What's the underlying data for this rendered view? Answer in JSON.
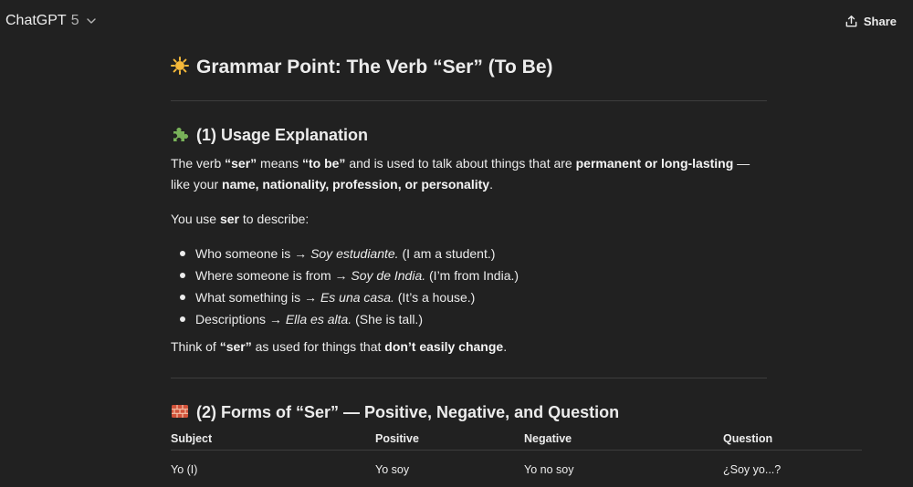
{
  "topbar": {
    "model_name": "ChatGPT",
    "model_version": "5",
    "share_label": "Share"
  },
  "content": {
    "title": "Grammar Point: The Verb “Ser” (To Be)",
    "section1": {
      "heading": "(1) Usage Explanation",
      "para1": {
        "t1": "The verb ",
        "b1": "“ser”",
        "t2": " means ",
        "b2": "“to be”",
        "t3": " and is used to talk about things that are ",
        "b3": "permanent or long-lasting",
        "t4": " — like your ",
        "b4": "name, nationality, profession, or personality",
        "t5": "."
      },
      "para2": {
        "t1": "You use ",
        "b1": "ser",
        "t2": " to describe:"
      },
      "bullets": [
        {
          "lead": "Who someone is → ",
          "example": "Soy estudiante.",
          "gloss": " (I am a student.)"
        },
        {
          "lead": "Where someone is from → ",
          "example": "Soy de India.",
          "gloss": " (I’m from India.)"
        },
        {
          "lead": "What something is → ",
          "example": "Es una casa.",
          "gloss": " (It’s a house.)"
        },
        {
          "lead": "Descriptions → ",
          "example": "Ella es alta.",
          "gloss": " (She is tall.)"
        }
      ],
      "para3": {
        "t1": "Think of ",
        "b1": "“ser”",
        "t2": " as used for things that ",
        "b2": "don’t easily change",
        "t3": "."
      }
    },
    "section2": {
      "heading": "(2) Forms of “Ser” — Positive, Negative, and Question",
      "table": {
        "headers": [
          "Subject",
          "Positive",
          "Negative",
          "Question"
        ],
        "rows": [
          [
            "Yo (I)",
            "Yo soy",
            "Yo no soy",
            "¿Soy yo...?"
          ]
        ]
      }
    }
  },
  "icons": {
    "model_dropdown": "chevron-down-icon",
    "share": "share-icon",
    "title_emoji": "sun-icon",
    "section1_emoji": "puzzle-piece-icon",
    "section2_emoji": "brick-icon"
  },
  "colors": {
    "background": "#212121",
    "text": "#ececec",
    "divider": "#3d3d3d",
    "sun": "#f5b93a",
    "puzzle": "#78b159",
    "brick": "#d0523a"
  }
}
